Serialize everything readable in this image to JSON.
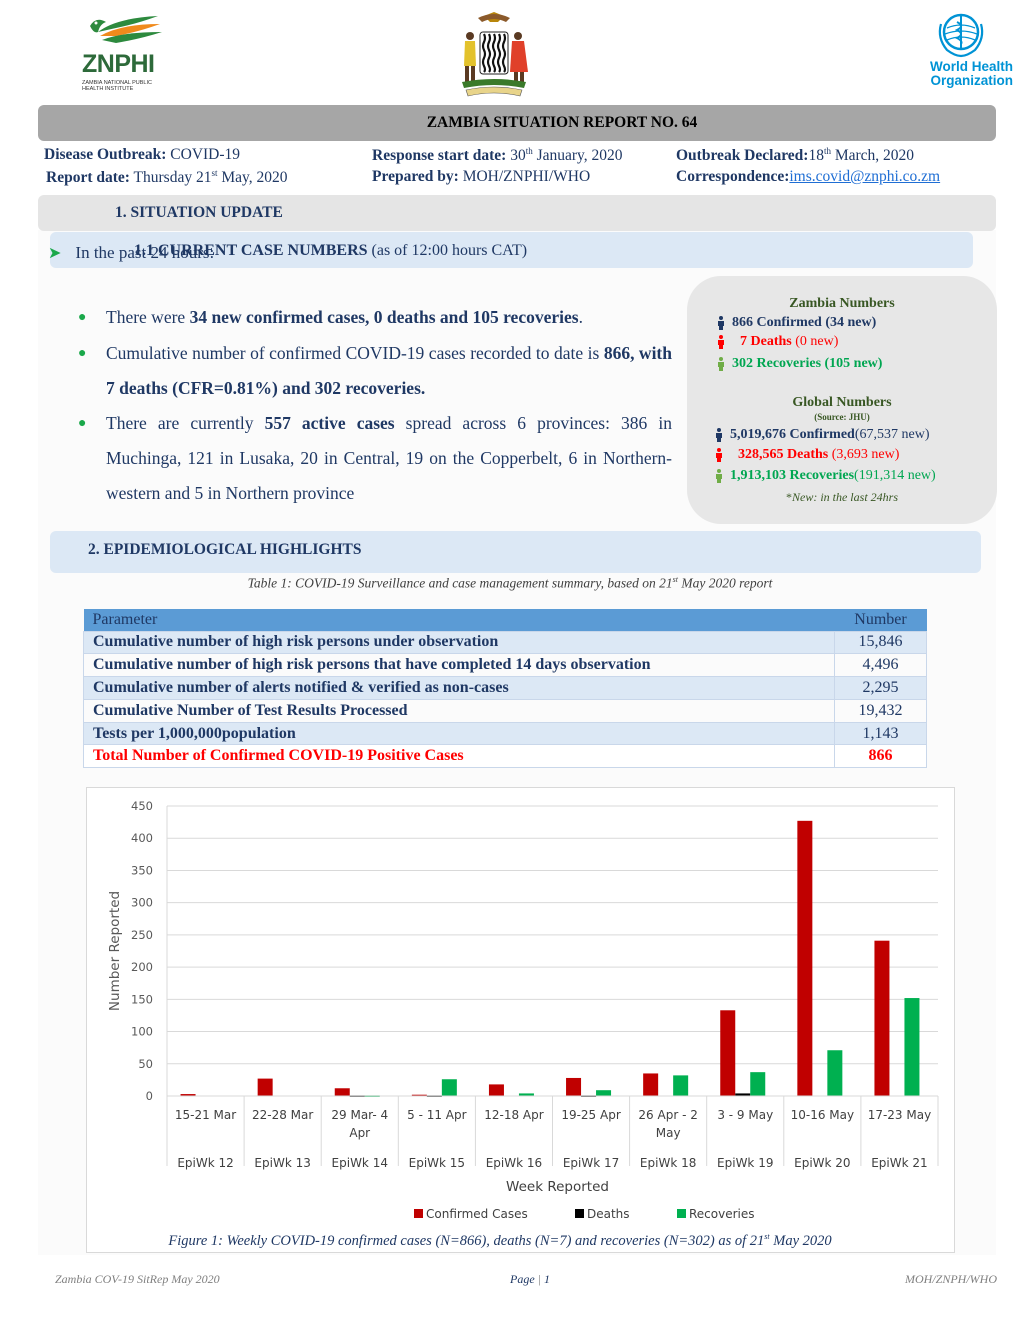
{
  "header": {
    "logos": {
      "left": {
        "icon": "znphi-bird-logo",
        "brand": "ZNPHI",
        "subtitle": "Zambia National Public Health Institute"
      },
      "center": {
        "icon": "zambia-coat-of-arms"
      },
      "right": {
        "icon": "who-emblem",
        "name_line1": "World Health",
        "name_line2": "Organization"
      }
    },
    "title": "ZAMBIA SITUATION REPORT NO. 64",
    "meta": {
      "disease_label": "Disease Outbreak:",
      "disease_value": "COVID-19",
      "response_label": "Response start date:",
      "response_day": "30",
      "response_sup": "th",
      "response_rest": " January, 2020",
      "declared_label": "Outbreak Declared:",
      "declared_day": "18",
      "declared_sup": "th",
      "declared_rest": " March, 2020",
      "report_label": "Report date:",
      "report_value_pre": "Thursday 21",
      "report_sup": "st",
      "report_value_post": " May, 2020",
      "prepared_label": "Prepared by:",
      "prepared_value": "MOH/ZNPHI/WHO",
      "correspondence_label": "Correspondence:",
      "correspondence_email": "ims.covid@znphi.co.zm"
    }
  },
  "section1": {
    "title": "1. SITUATION UPDATE",
    "sub_title_bold": "1.1 CURRENT CASE NUMBERS",
    "sub_title_rest": " (as of 12:00 hours CAT)",
    "intro": "In the past 24 hours:",
    "bullets": [
      {
        "pre": "There were ",
        "bold": "34 new confirmed cases, 0 deaths and 105 recoveries",
        "post": "."
      },
      {
        "pre": "Cumulative number of confirmed COVID-19 cases recorded to date is ",
        "bold": "866, with 7 deaths (CFR=0.81%) and 302 recoveries.",
        "post": ""
      },
      {
        "pre": "There are currently ",
        "bold": "557 active cases",
        "post": " spread across 6 provinces: 386 in Muchinga, 121 in Lusaka, 20 in Central, 19 on the Copperbelt, 6 in Northern-western and 5 in Northern province"
      }
    ]
  },
  "numbers_box": {
    "zambia_title": "Zambia Numbers",
    "zambia": [
      {
        "icon": "person-icon",
        "bold": "866 Confirmed (34 new)",
        "rest": "",
        "color": "#1f3864"
      },
      {
        "icon": "person-icon",
        "bold": "7 Deaths",
        "rest": " (0 new)",
        "color": "#ff0000"
      },
      {
        "icon": "person-icon",
        "bold": "302 Recoveries (105 new)",
        "rest": "",
        "color": "#00a651"
      }
    ],
    "global_title": "Global Numbers",
    "global_source": "(Source: JHU)",
    "global": [
      {
        "icon": "person-icon",
        "bold": "5,019,676 Confirmed",
        "rest": " (67,537 new)",
        "color": "#1f3864"
      },
      {
        "icon": "person-icon",
        "bold": "328,565 Deaths",
        "rest": " (3,693 new)",
        "color": "#ff0000"
      },
      {
        "icon": "person-icon",
        "bold": "1,913,103 Recoveries",
        "rest": " (191,314 new)",
        "color": "#00a651"
      }
    ],
    "note_star": "*",
    "note": "New: in the last 24hrs"
  },
  "section2": {
    "title": "2.  EPIDEMIOLOGICAL HIGHLIGHTS",
    "table_caption_pre": "Table 1: COVID-19 Surveillance and case management summary, based on 21",
    "table_caption_sup": "st",
    "table_caption_post": " May 2020 report",
    "table": {
      "headers": [
        "Parameter",
        "Number"
      ],
      "rows": [
        [
          "Cumulative number of high risk persons under observation",
          "15,846"
        ],
        [
          "Cumulative number of high risk persons that have completed 14 days observation",
          "4,496"
        ],
        [
          "Cumulative number of alerts notified & verified as non-cases",
          "2,295"
        ],
        [
          "Cumulative Number of Test Results Processed",
          "19,432"
        ],
        [
          "Tests per 1,000,000population",
          "1,143"
        ],
        [
          "Total Number of Confirmed COVID-19 Positive Cases",
          "866"
        ]
      ]
    },
    "figure_caption_pre": "Figure 1: Weekly COVID-19 confirmed cases (N=866), deaths (N=7) and recoveries (N=302) as of 21",
    "figure_caption_sup": "st",
    "figure_caption_post": " May 2020"
  },
  "chart_data": {
    "type": "bar",
    "title": "",
    "xlabel": "Week Reported",
    "ylabel": "Number Reported",
    "ylim": [
      0,
      450
    ],
    "yticks": [
      0,
      50,
      100,
      150,
      200,
      250,
      300,
      350,
      400,
      450
    ],
    "grid": true,
    "legend": "bottom-center",
    "categories": [
      {
        "dates": [
          "15-21 Mar"
        ],
        "week": "EpiWk 12"
      },
      {
        "dates": [
          "22-28 Mar"
        ],
        "week": "EpiWk 13"
      },
      {
        "dates": [
          "29 Mar- 4",
          "Apr"
        ],
        "week": "EpiWk 14"
      },
      {
        "dates": [
          "5 - 11  Apr"
        ],
        "week": "EpiWk 15"
      },
      {
        "dates": [
          "12-18 Apr"
        ],
        "week": "EpiWk 16"
      },
      {
        "dates": [
          "19-25 Apr"
        ],
        "week": "EpiWk 17"
      },
      {
        "dates": [
          "26 Apr - 2",
          "May"
        ],
        "week": "EpiWk 18"
      },
      {
        "dates": [
          "3 - 9 May"
        ],
        "week": "EpiWk 19"
      },
      {
        "dates": [
          "10-16 May"
        ],
        "week": "EpiWk 20"
      },
      {
        "dates": [
          "17-23 May"
        ],
        "week": "EpiWk 21"
      }
    ],
    "series": [
      {
        "name": "Confirmed Cases",
        "color": "#c00000",
        "values": [
          3,
          27,
          12,
          2,
          18,
          28,
          35,
          133,
          427,
          241
        ]
      },
      {
        "name": "Deaths",
        "color": "#000000",
        "values": [
          0,
          0,
          1,
          1,
          0,
          1,
          0,
          4,
          0,
          0
        ]
      },
      {
        "name": "Recoveries",
        "color": "#00b050",
        "values": [
          0,
          0,
          1,
          26,
          4,
          9,
          32,
          37,
          71,
          152
        ]
      }
    ]
  },
  "footer": {
    "left": "Zambia COV-19 SitRep May 2020",
    "center_label": "Page",
    "center_sep": " | ",
    "center_num": "1",
    "right": "MOH/ZNPH/WHO"
  }
}
